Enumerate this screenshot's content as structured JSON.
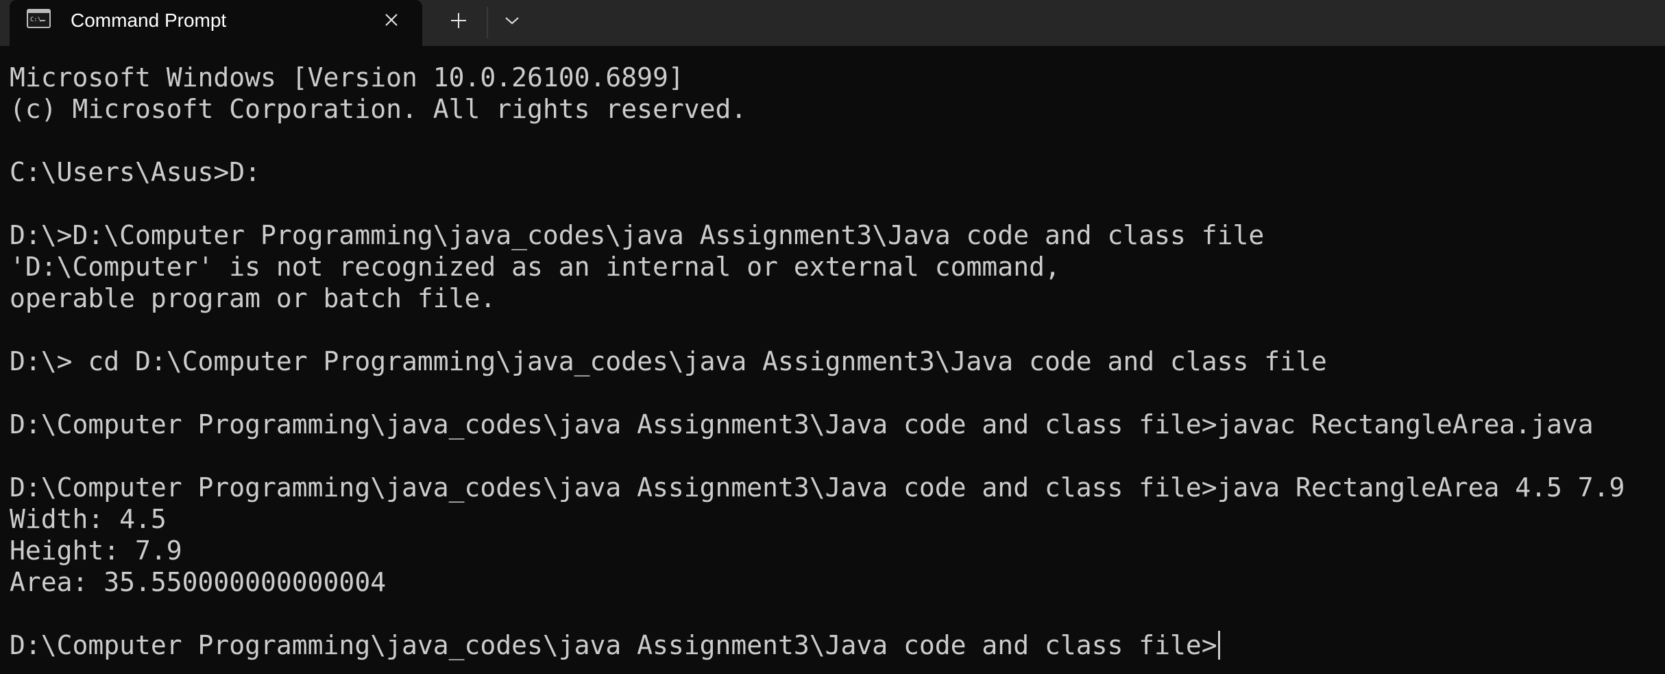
{
  "window": {
    "tab_title": "Command Prompt",
    "tab_icon": "cmd-terminal-icon",
    "close_icon": "close-icon",
    "new_tab_icon": "plus-icon",
    "dropdown_icon": "chevron-down-icon"
  },
  "colors": {
    "background": "#0c0c0c",
    "titlebar": "#272727",
    "text": "#cccccc"
  },
  "console": {
    "lines": [
      "Microsoft Windows [Version 10.0.26100.6899]",
      "(c) Microsoft Corporation. All rights reserved.",
      "",
      "C:\\Users\\Asus>D:",
      "",
      "D:\\>D:\\Computer Programming\\java_codes\\java Assignment3\\Java code and class file",
      "'D:\\Computer' is not recognized as an internal or external command,",
      "operable program or batch file.",
      "",
      "D:\\> cd D:\\Computer Programming\\java_codes\\java Assignment3\\Java code and class file",
      "",
      "D:\\Computer Programming\\java_codes\\java Assignment3\\Java code and class file>javac RectangleArea.java",
      "",
      "D:\\Computer Programming\\java_codes\\java Assignment3\\Java code and class file>java RectangleArea 4.5 7.9",
      "Width: 4.5",
      "Height: 7.9",
      "Area: 35.550000000000004",
      "",
      "D:\\Computer Programming\\java_codes\\java Assignment3\\Java code and class file>"
    ]
  }
}
